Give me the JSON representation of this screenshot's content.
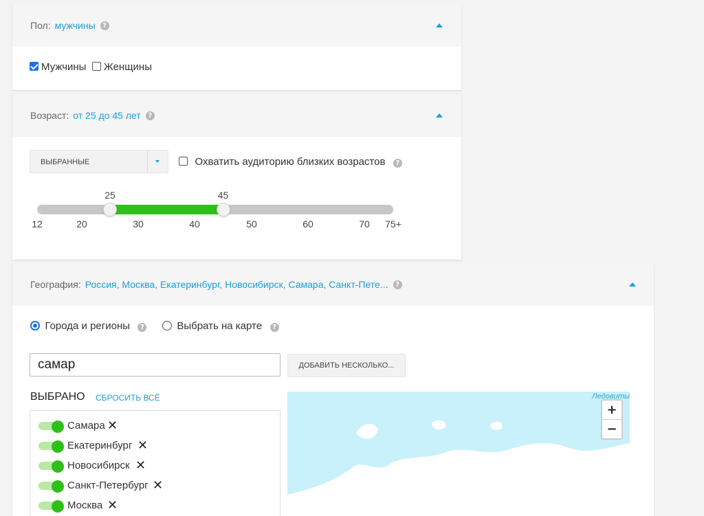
{
  "gender": {
    "label": "Пол:",
    "value": "мужчины",
    "options": [
      {
        "label": "Мужчины",
        "checked": true
      },
      {
        "label": "Женщины",
        "checked": false
      }
    ]
  },
  "age": {
    "label": "Возраст:",
    "value": "от 25 до 45 лет",
    "select_value": "ВЫБРАННЫЕ",
    "cover_label": "Охватить аудиторию близких возрастов",
    "cover_checked": false,
    "range": {
      "min": 12,
      "max": 75,
      "from": 25,
      "to": 45
    },
    "ticks": [
      "12",
      "20",
      "30",
      "40",
      "50",
      "60",
      "70",
      "75+"
    ],
    "handle_labels": [
      "25",
      "45"
    ]
  },
  "geo": {
    "label": "География:",
    "value": "Россия, Москва, Екатеринбург, Новосибирск, Самара, Санкт-Пете...",
    "radio_cities": "Города и регионы",
    "radio_map": "Выбрать на карте",
    "search_value": "самар",
    "add_button": "ДОБАВИТЬ НЕСКОЛЬКО...",
    "selected_title": "ВЫБРАНО",
    "reset_label": "СБРОСИТЬ ВСЁ",
    "selected": [
      "Самара",
      "Екатеринбург",
      "Новосибирск",
      "Санкт-Петербург",
      "Москва"
    ],
    "map_label": "Ледовиты",
    "zoom_in": "+",
    "zoom_out": "−"
  },
  "colors": {
    "accent": "#1a9fd9",
    "slider_fill": "#2fbf1a",
    "map_water": "#c8f1fb"
  },
  "icons": {
    "help": "?",
    "remove": "✕"
  }
}
